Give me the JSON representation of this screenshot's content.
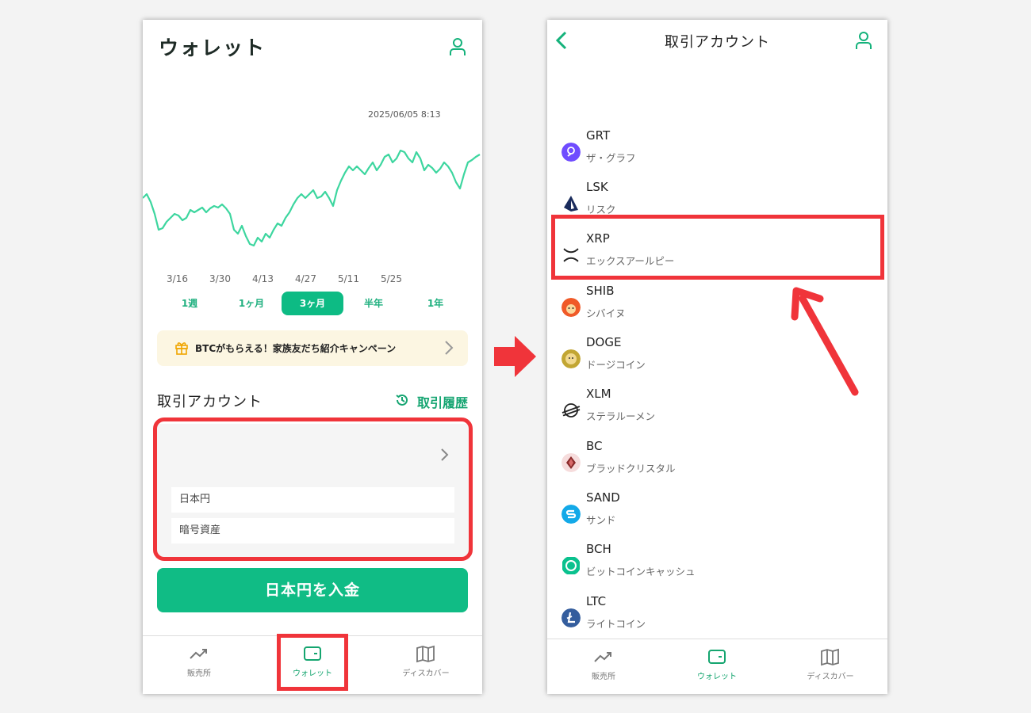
{
  "left": {
    "title": "ウォレット",
    "chart_timestamp": "2025/06/05 8:13",
    "chart_data": {
      "type": "line",
      "x_tick_labels": [
        "3/16",
        "3/30",
        "4/13",
        "4/27",
        "5/11",
        "5/25"
      ],
      "series_color": "#3dd69f",
      "grid": false
    },
    "range_tabs": [
      {
        "label": "1週",
        "active": false
      },
      {
        "label": "1ヶ月",
        "active": false
      },
      {
        "label": "3ヶ月",
        "active": true
      },
      {
        "label": "半年",
        "active": false
      },
      {
        "label": "1年",
        "active": false
      }
    ],
    "promo_text": "BTCがもらえる！家族友だち紹介キャンペーン",
    "section_title": "取引アカウント",
    "history_label": "取引履歴",
    "card_rows": [
      "日本円",
      "暗号資産"
    ],
    "deposit_button": "日本円を入金",
    "tabs": [
      {
        "label": "販売所",
        "icon": "trend-icon",
        "active": false
      },
      {
        "label": "ウォレット",
        "icon": "wallet-icon",
        "active": true
      },
      {
        "label": "ディスカバー",
        "icon": "map-icon",
        "active": false
      }
    ]
  },
  "right": {
    "title": "取引アカウント",
    "coins": [
      {
        "symbol": "GRT",
        "name": "ザ・グラフ",
        "icon": "grt-icon",
        "color": "#6f4cff"
      },
      {
        "symbol": "LSK",
        "name": "リスク",
        "icon": "lsk-icon",
        "color": "#1a2b5c"
      },
      {
        "symbol": "XRP",
        "name": "エックスアールピー",
        "icon": "xrp-icon",
        "color": "#222222"
      },
      {
        "symbol": "SHIB",
        "name": "シバイヌ",
        "icon": "shib-icon",
        "color": "#f05a28"
      },
      {
        "symbol": "DOGE",
        "name": "ドージコイン",
        "icon": "doge-icon",
        "color": "#c2a633"
      },
      {
        "symbol": "XLM",
        "name": "ステラルーメン",
        "icon": "xlm-icon",
        "color": "#222222"
      },
      {
        "symbol": "BC",
        "name": "ブラッドクリスタル",
        "icon": "bc-icon",
        "color": "#f2c7c7"
      },
      {
        "symbol": "SAND",
        "name": "サンド",
        "icon": "sand-icon",
        "color": "#13a9e8"
      },
      {
        "symbol": "BCH",
        "name": "ビットコインキャッシュ",
        "icon": "bch-icon",
        "color": "#0ac18e"
      },
      {
        "symbol": "LTC",
        "name": "ライトコイン",
        "icon": "ltc-icon",
        "color": "#345d9d"
      }
    ],
    "tabs": [
      {
        "label": "販売所",
        "icon": "trend-icon",
        "active": false
      },
      {
        "label": "ウォレット",
        "icon": "wallet-icon",
        "active": true
      },
      {
        "label": "ディスカバー",
        "icon": "map-icon",
        "active": false
      }
    ]
  },
  "colors": {
    "accent": "#10bc85",
    "highlight": "#f0343a",
    "promo_bg": "#fcf6e2"
  }
}
